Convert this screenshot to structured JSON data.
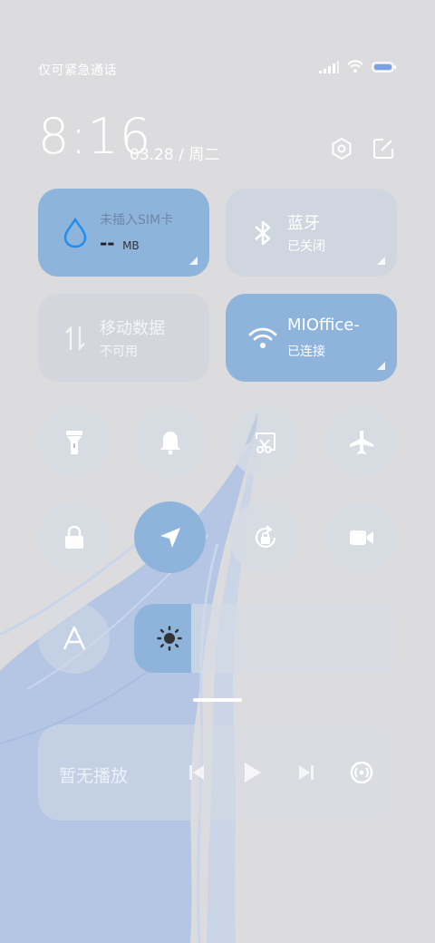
{
  "status_bar": {
    "carrier_text": "仅可紧急通话"
  },
  "header": {
    "time": "8:16",
    "date": "03.28 / 周二"
  },
  "tiles": {
    "sim": {
      "title": "未插入SIM卡",
      "value": "--",
      "unit": "MB"
    },
    "bluetooth": {
      "title": "蓝牙",
      "status": "已关闭"
    },
    "mobile_data": {
      "title": "移动数据",
      "status": "不可用"
    },
    "wifi": {
      "title": "MIOffice-",
      "status": "已连接"
    }
  },
  "media": {
    "label": "暂无播放"
  },
  "colors": {
    "accent": "#8fb4db",
    "background": "#dcdcde",
    "wave": "#b3c5e3"
  }
}
